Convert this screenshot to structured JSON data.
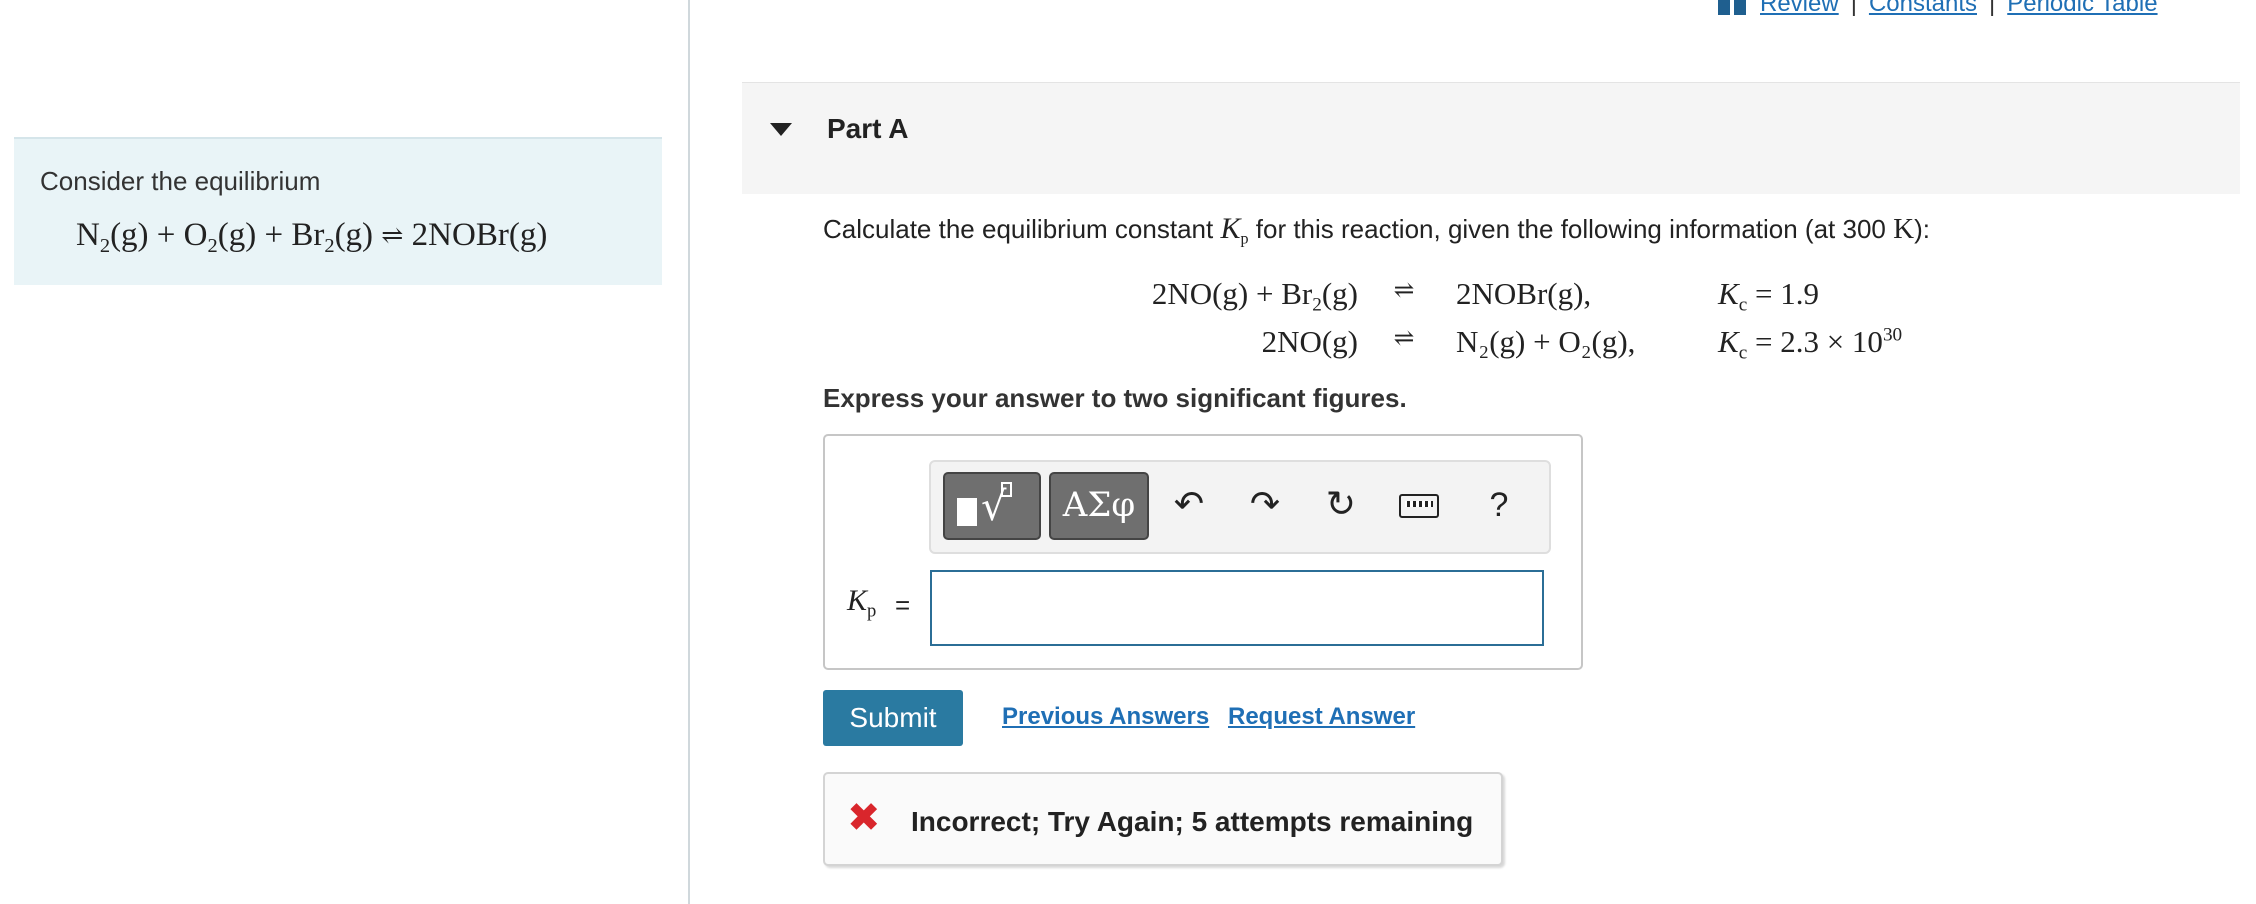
{
  "context": {
    "intro": "Consider the equilibrium",
    "equation": {
      "n2": "N",
      "n2_sub": "2",
      "o2": "O",
      "o2_sub": "2",
      "br2": "Br",
      "br2_sub": "2",
      "phase": "(g)",
      "plus": "+",
      "arrow": "⇌",
      "product": "2NOBr(g)"
    }
  },
  "top_links": {
    "review": "Review",
    "constants": "Constants",
    "periodic_table": "Periodic Table",
    "separator": "|"
  },
  "part": {
    "title": "Part A"
  },
  "question": {
    "before": "Calculate the equilibrium constant ",
    "k_symbol": "K",
    "k_sub": "p",
    "after": " for this reaction, given the following information (at 300 ",
    "unit": "K",
    "end": "):"
  },
  "given": [
    {
      "lhs": "2NO(g) + Br",
      "lhs_sub": "2",
      "lhs_tail": "(g)",
      "arrow": "⇌",
      "rhs": "2NOBr(g),",
      "k": "K",
      "k_sub": "c",
      "k_val": " = 1.9",
      "k_exp": ""
    },
    {
      "lhs": "2NO(g)",
      "lhs_sub": "",
      "lhs_tail": "",
      "arrow": "⇌",
      "rhs": "N₂(g) + O₂(g),",
      "k": "K",
      "k_sub": "c",
      "k_val": " = 2.3 × 10",
      "k_exp": "30"
    }
  ],
  "instruction": "Express your answer to two significant figures.",
  "toolbar": {
    "greek_label": "ΑΣφ",
    "undo": "↶",
    "redo": "↷",
    "reset": "↻",
    "help": "?"
  },
  "answer": {
    "label": "K",
    "label_sub": "p",
    "equals": "=",
    "value": ""
  },
  "actions": {
    "submit": "Submit",
    "previous_answers": "Previous Answers",
    "request_answer": "Request Answer"
  },
  "feedback": {
    "icon": "✖",
    "message": "Incorrect; Try Again; 5 attempts remaining"
  },
  "colors": {
    "intro_bg": "#e9f4f7",
    "link": "#1f6fb5",
    "submit_bg": "#2a7aa1",
    "error": "#d9262c"
  }
}
